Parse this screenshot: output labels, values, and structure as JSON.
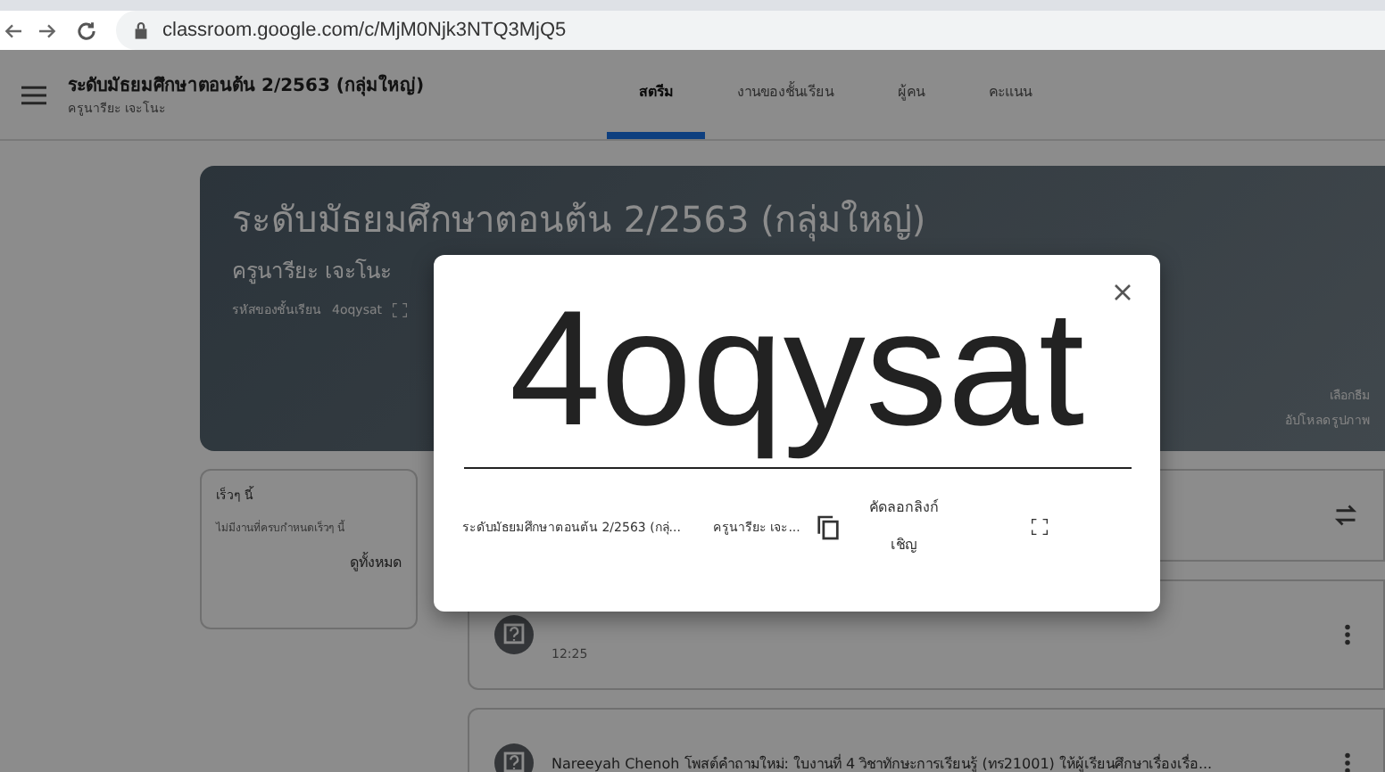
{
  "browser": {
    "url": "classroom.google.com/c/MjM0Njk3NTQ3MjQ5"
  },
  "header": {
    "title": "ระดับมัธยมศึกษาตอนต้น 2/2563 (กลุ่มใหญ่)",
    "subtitle": "ครูนารียะ เจะโนะ",
    "tabs": [
      {
        "label": "สตรีม",
        "selected": true
      },
      {
        "label": "งานของชั้นเรียน",
        "selected": false
      },
      {
        "label": "ผู้คน",
        "selected": false
      },
      {
        "label": "คะแนน",
        "selected": false
      }
    ]
  },
  "banner": {
    "title": "ระดับมัธยมศึกษาตอนต้น 2/2563 (กลุ่มใหญ่)",
    "teacher": "ครูนารียะ เจะโนะ",
    "code_label": "รหัสของชั้นเรียน",
    "code": "4oqysat",
    "links": [
      "เลือกธีม",
      "อัปโหลดรูปภาพ"
    ]
  },
  "upcoming": {
    "title": "เร็วๆ นี้",
    "message": "ไม่มีงานที่ครบกำหนดเร็วๆ นี้",
    "link": "ดูทั้งหมด"
  },
  "posts": [
    {
      "time": "12:25"
    },
    {
      "text": "Nareeyah Chenoh โพสต์คำถามใหม่: ใบงานที่ 4 วิชาทักษะการเรียนรู้ (ทร21001) ให้ผู้เรียนศึกษาเรื่องเรื่อ..."
    }
  ],
  "dialog": {
    "code": "4oqysat",
    "class_name": "ระดับมัธยมศึกษาตอนต้น 2/2563 (กลุ่...",
    "teacher": "ครูนารียะ เจะ...",
    "copy_link": "คัดลอกลิงก์เชิญ"
  }
}
